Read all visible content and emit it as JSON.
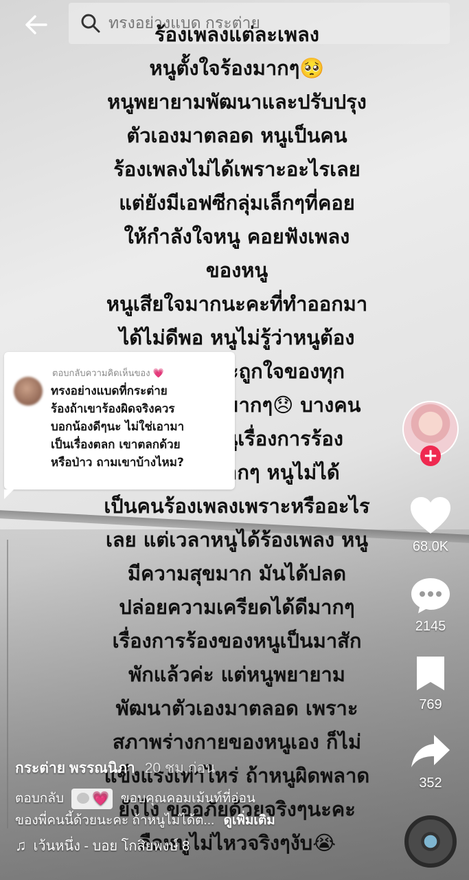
{
  "search": {
    "query": "ทรงอย่างแบด กระต่าย"
  },
  "video_text": "ร้องเพลงแต่ละเพลง\nหนูตั้งใจร้องมากๆ🥺\nหนูพยายามพัฒนาและปรับปรุง\nตัวเองมาตลอด หนูเป็นคน\nร้องเพลงไม่ได้เพราะอะไรเลย\nแต่ยังมีเอฟซีกลุ่มเล็กๆที่คอย\nให้กำลังใจหนู คอยฟังเพลง\nของหนู\nหนูเสียใจมากนะคะที่ทำออกมา\nได้ไม่ดีพอ หนูไม่รู้ว่าหนูต้อง\nทำยังไงถึงจะถูกใจของทุก\nคน หนูเสียใจมากๆ😞 บางคน\nก็ล้อเลียนหนูเรื่องการร้อง\nหนูเสียใจมากๆ หนูไม่ได้\nเป็นคนร้องเพลงเพราะหรืออะไร\nเลย แต่เวลาหนูได้ร้องเพลง หนู\nมีความสุขมาก มันได้ปลด\nปล่อยความเครียดได้ดีมากๆ\nเรื่องการร้องของหนูเป็นมาสัก\nพักแล้วค่ะ แต่หนูพยายาม\nพัฒนาตัวเองมาตลอด เพราะ\nสภาพร่างกายของหนูเอง ก็ไม่\nแข็งแรงเท่าไหร่ ถ้าหนูผิดพลาด\nยังไง ขออภัยด้วยจริงๆนะคะ\nคือหนูไม่ไหวจริงๆงับ😭",
  "reply_card": {
    "header": "ตอบกลับความคิดเห็นของ",
    "heart": "💗",
    "body": "ทรงอย่างแบดที่กระต่าย\nร้องถ้าเขาร้องผิดจริงควร\nบอกน้องดีๆนะ ไม่ใช่เอามา\nเป็นเรื่องตลก เขาตลกด้วย\nหรือป่าว ถามเขาบ้างไหม?"
  },
  "rail": {
    "likes": "68.0K",
    "comments": "2145",
    "saves": "769",
    "shares": "352",
    "follow": "+"
  },
  "bottom": {
    "author": "กระต่าย พรรณนิภา",
    "time": "20 ชม.ก่อน",
    "caption_prefix": "ตอบกลับ",
    "caption_main": "ขอบคุณคอมเม้นท์ที่อ่อน",
    "caption_line2": "ของพี่คนนี้ด้วยนะคะ ถ้าหนูไม่ได้ต...",
    "more": "ดูเพิ่มเติม",
    "music": "เว้นหนึ่ง - บอย โกสิยพงษ์ 8"
  },
  "colors": {
    "follow": "#ef2950",
    "heart_pink": "#e63e8c"
  }
}
